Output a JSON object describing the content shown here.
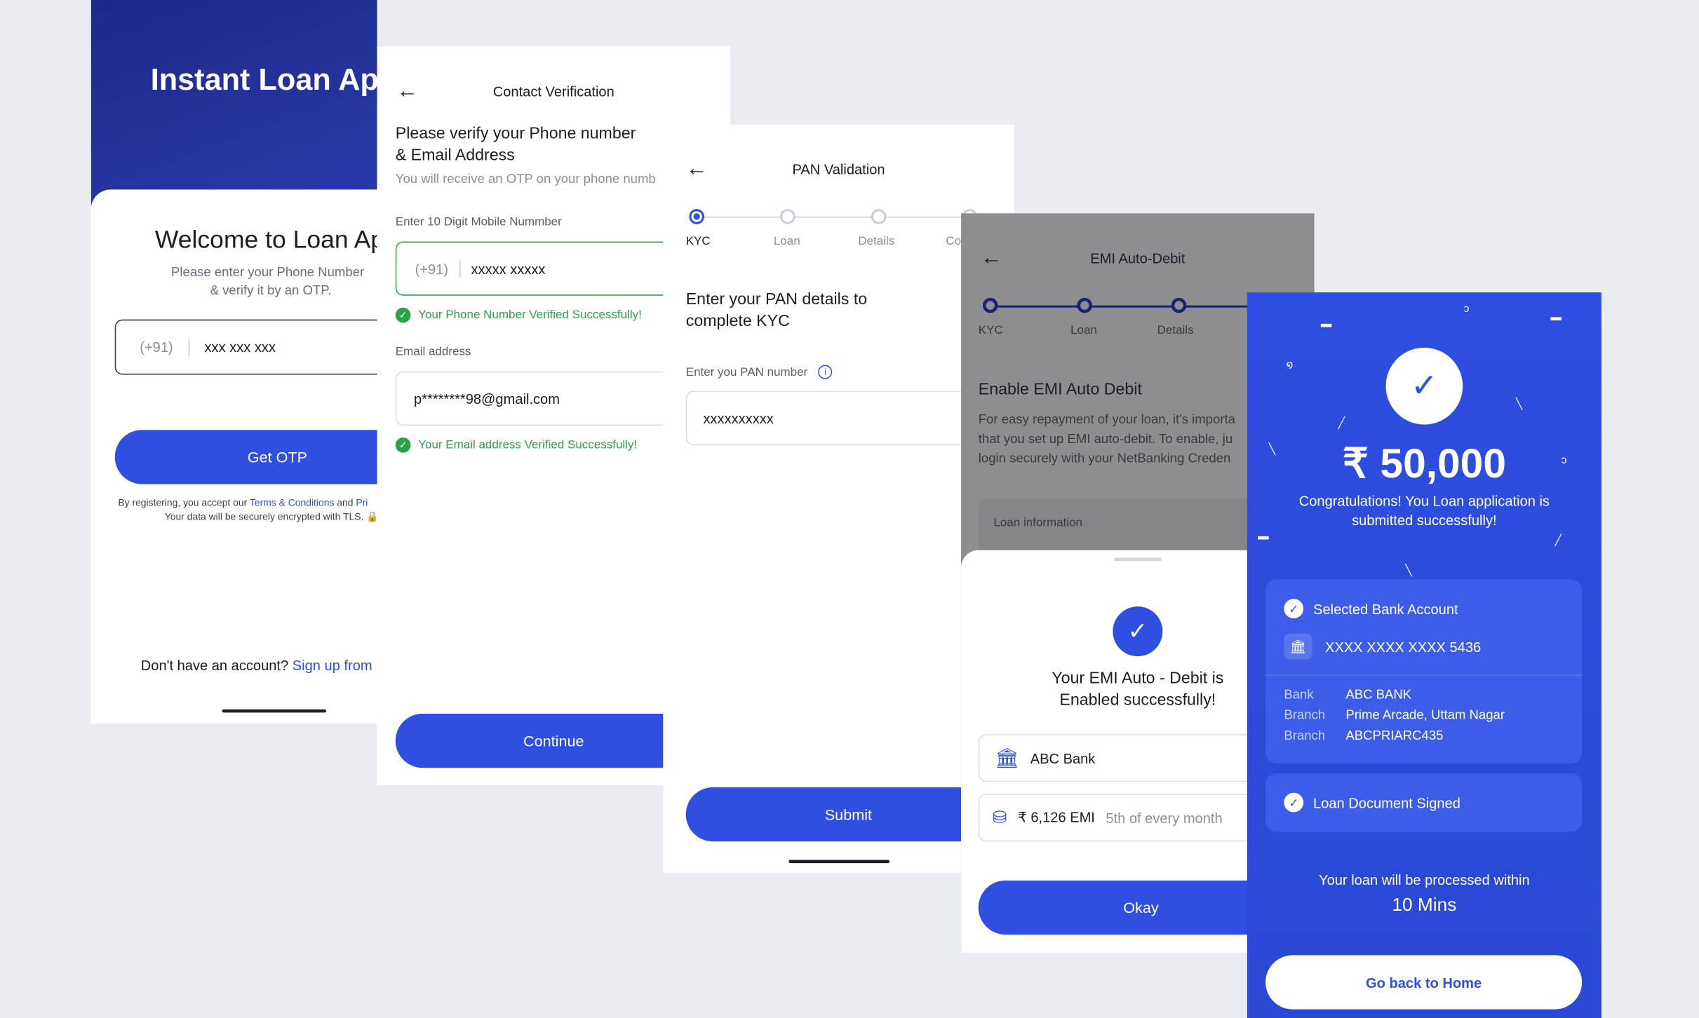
{
  "colors": {
    "primary": "#2f4ee2",
    "success": "#2ba14a",
    "dark_navy": "#1f2f8f",
    "background": "#e9edf1"
  },
  "login": {
    "hero_title": "Instant Loan Ap",
    "welcome": "Welcome to Loan Ap",
    "sub_line1": "Please enter your Phone Number",
    "sub_line2": "& verify it by an OTP.",
    "country_code": "(+91)",
    "phone_value": "xxx xxx xxx",
    "cta": "Get OTP",
    "legal_prefix": "By registering, you accept our ",
    "legal_terms": "Terms & Conditions",
    "legal_and": " and ",
    "legal_privacy": "Pri",
    "legal_line2": "Your data will be securely encrypted with TLS. 🔒",
    "no_account": "Don't have an account? ",
    "signup": "Sign up from"
  },
  "contact": {
    "title": "Contact Verification",
    "heading_line1": "Please verify your Phone number",
    "heading_line2": "& Email Address",
    "sub": "You will receive an OTP on your phone numb",
    "mobile_label": "Enter 10 Digit Mobile Nummber",
    "country_code": "(+91)",
    "mobile_value": "xxxxx xxxxx",
    "phone_ok": "Your Phone Number Verified Successfully!",
    "email_label": "Email address",
    "email_value": "p********98@gmail.com",
    "email_ok": "Your Email address Verified Successfully!",
    "cta": "Continue"
  },
  "pan": {
    "title": "PAN Validation",
    "steps": [
      "KYC",
      "Loan",
      "Details",
      "Co"
    ],
    "heading_line1": "Enter your PAN details to",
    "heading_line2": "complete KYC",
    "field_label": "Enter you PAN number",
    "field_value": "xxxxxxxxxx",
    "cta": "Submit"
  },
  "emi": {
    "title": "EMI Auto-Debit",
    "steps": [
      "KYC",
      "Loan",
      "Details"
    ],
    "heading": "Enable EMI Auto Debit",
    "desc_line1": "For easy repayment of your loan, it's importa",
    "desc_line2": "that you set up EMI auto-debit. To enable, ju",
    "desc_line3": "login securely with your NetBanking Creden",
    "loan_info": "Loan information",
    "success_line1": "Your EMI Auto - Debit is",
    "success_line2": "Enabled successfully!",
    "bank": "ABC Bank",
    "emi_amount": "₹ 6,126 EMI",
    "emi_schedule": "5th of every month",
    "cta": "Okay"
  },
  "success": {
    "amount": "₹ 50,000",
    "msg_line1": "Congratulations! You Loan application is",
    "msg_line2": "submitted successfully!",
    "selected_bank": "Selected Bank Account",
    "account_number": "XXXX XXXX XXXX 5436",
    "bank_label": "Bank",
    "bank_value": "ABC BANK",
    "branch_label": "Branch",
    "branch_value": "Prime Arcade, Uttam Nagar",
    "branch_code_label": "Branch",
    "branch_code_value": "ABCPRIARC435",
    "doc_signed": "Loan Document Signed",
    "process_line": "Your loan will be processed within",
    "process_time": "10 Mins",
    "cta": "Go back to Home"
  }
}
